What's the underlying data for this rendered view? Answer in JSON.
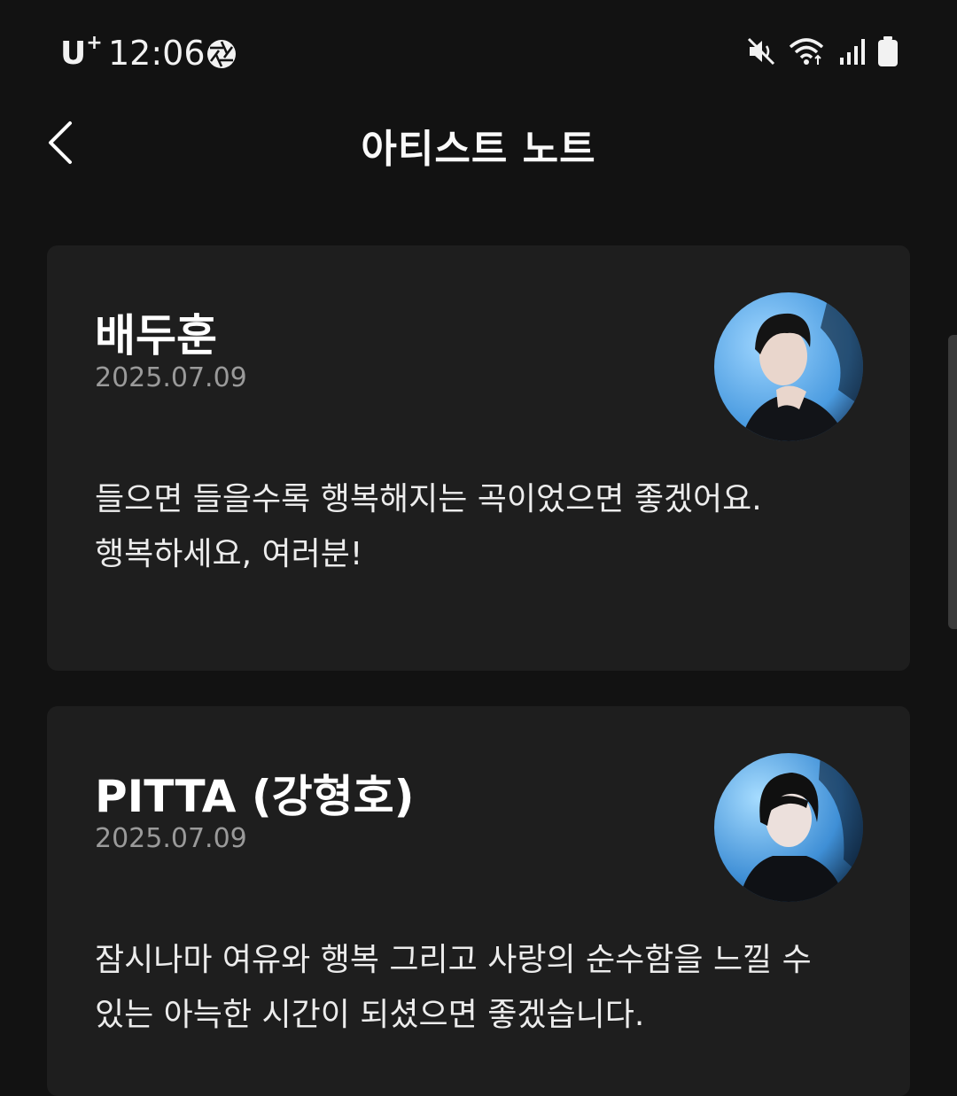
{
  "status_bar": {
    "carrier": "U",
    "carrier_suffix": "+",
    "time": "12:06",
    "icons": [
      "aperture-icon",
      "mute-icon",
      "wifi-icon",
      "signal-icon",
      "battery-icon"
    ]
  },
  "header": {
    "title": "아티스트 노트",
    "back_icon": "chevron-left-icon"
  },
  "notes": [
    {
      "artist": "배두훈",
      "date": "2025.07.09",
      "lines": [
        "들으면 들을수록 행복해지는 곡이었으면 좋겠어요.",
        "행복하세요, 여러분!"
      ]
    },
    {
      "artist": "PITTA (강형호)",
      "date": "2025.07.09",
      "lines": [
        "잠시나마 여유와 행복 그리고 사랑의 순수함을 느낄 수",
        "있는 아늑한 시간이 되셨으면 좋겠습니다."
      ]
    }
  ],
  "colors": {
    "background": "#121212",
    "card": "#1e1e1e",
    "date": "#9a9a9a"
  }
}
